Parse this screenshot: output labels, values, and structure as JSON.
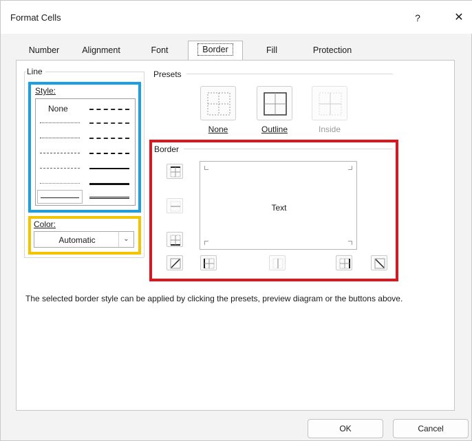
{
  "window": {
    "title": "Format Cells",
    "help": "?",
    "close": "✕"
  },
  "tabs": [
    "Number",
    "Alignment",
    "Font",
    "Border",
    "Fill",
    "Protection"
  ],
  "line_group": {
    "label": "Line",
    "style_label": "Style:",
    "style_none": "None",
    "color_label": "Color:",
    "color_value": "Automatic"
  },
  "presets": {
    "label": "Presets",
    "items": [
      {
        "label": "None",
        "enabled": true
      },
      {
        "label": "Outline",
        "enabled": true
      },
      {
        "label": "Inside",
        "enabled": false
      }
    ]
  },
  "border_group": {
    "label": "Border",
    "preview_text": "Text"
  },
  "help_text": "The selected border style can be applied by clicking the presets, preview diagram or the buttons above.",
  "footer": {
    "ok": "OK",
    "cancel": "Cancel"
  },
  "highlight_colors": {
    "style": "#1aa0e0",
    "color": "#f5c400",
    "border": "#e0141e"
  }
}
